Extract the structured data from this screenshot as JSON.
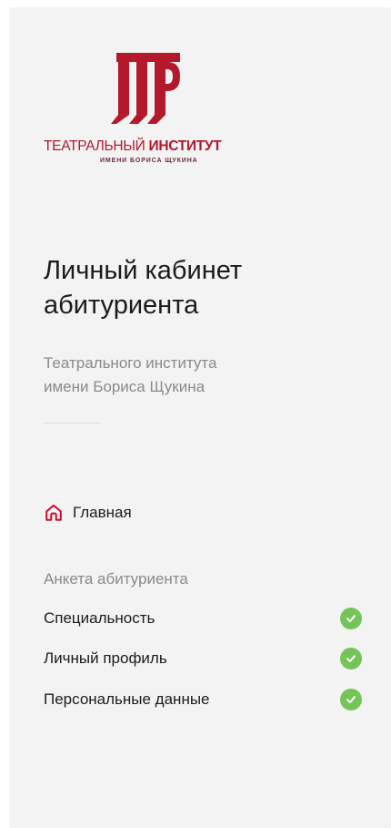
{
  "logo": {
    "title_light": "ТЕАТРАЛЬНЫЙ ",
    "title_bold": "ИНСТИТУТ",
    "subtitle": "ИМЕНИ БОРИСА ЩУКИНА",
    "mark_icon": "institute-emblem-icon",
    "brand_color": "#b3182b"
  },
  "header": {
    "title_line1": "Личный кабинет",
    "title_line2": "абитуриента",
    "subtitle_line1": "Театрального института",
    "subtitle_line2": "имени Бориса Щукина"
  },
  "nav": {
    "home_label": "Главная",
    "home_icon": "house-icon",
    "home_icon_color": "#c8102e"
  },
  "questionnaire": {
    "section_title": "Анкета абитуриента",
    "items": [
      {
        "label": "Специальность",
        "status": "completed",
        "icon": "check-circle-icon"
      },
      {
        "label": "Личный профиль",
        "status": "completed",
        "icon": "check-circle-icon"
      },
      {
        "label": "Персональные данные",
        "status": "completed",
        "icon": "check-circle-icon"
      }
    ],
    "completed_color": "#75c45a"
  }
}
